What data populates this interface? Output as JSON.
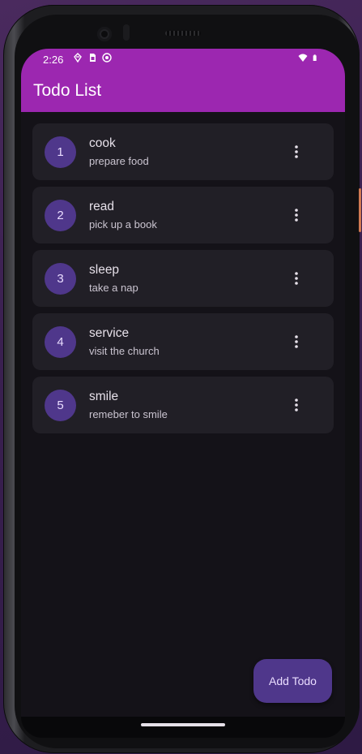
{
  "status_bar": {
    "time": "2:26",
    "left_icons": [
      "data-saver-icon",
      "sim-card-icon",
      "app-notification-icon"
    ],
    "right_icons": [
      "wifi-icon",
      "battery-icon"
    ]
  },
  "app_bar": {
    "title": "Todo List"
  },
  "todos": [
    {
      "number": "1",
      "title": "cook",
      "description": "prepare food"
    },
    {
      "number": "2",
      "title": "read",
      "description": "pick up a book"
    },
    {
      "number": "3",
      "title": "sleep",
      "description": "take a nap"
    },
    {
      "number": "4",
      "title": "service",
      "description": "visit the church"
    },
    {
      "number": "5",
      "title": "smile",
      "description": "remeber to smile"
    }
  ],
  "fab": {
    "label": "Add Todo"
  },
  "colors": {
    "app_bar": "#9c27b0",
    "background": "#141218",
    "card": "#211f26",
    "avatar": "#4f378b",
    "fab": "#4f378b"
  }
}
